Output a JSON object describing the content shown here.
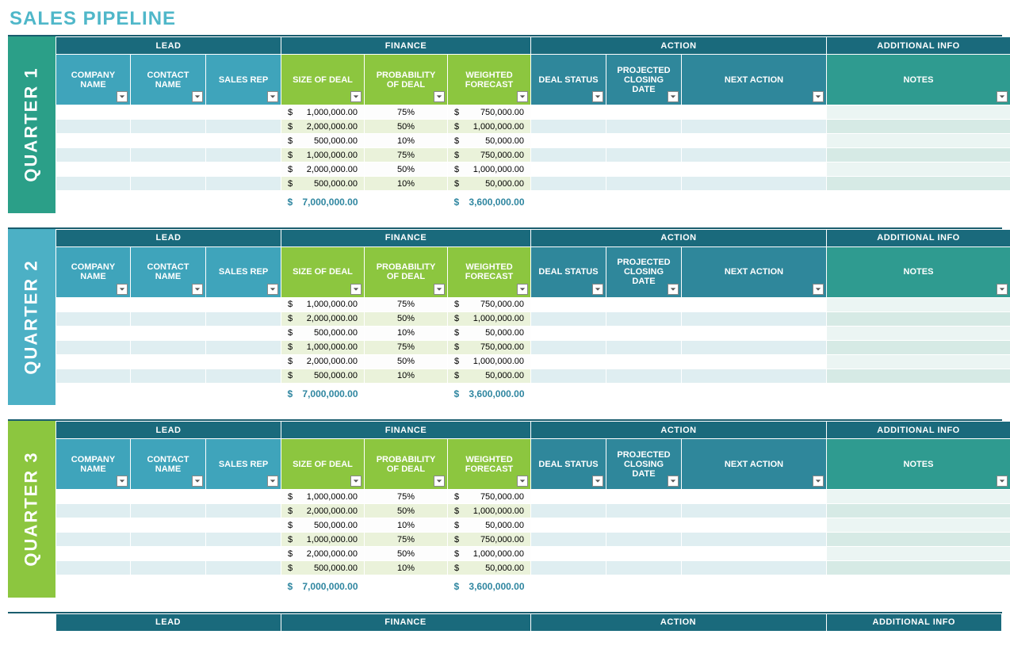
{
  "title": "SALES PIPELINE",
  "group_headers": {
    "lead": "LEAD",
    "finance": "FINANCE",
    "action": "ACTION",
    "info": "ADDITIONAL INFO"
  },
  "col_headers": {
    "company": "COMPANY NAME",
    "contact": "CONTACT NAME",
    "rep": "SALES REP",
    "size": "SIZE OF DEAL",
    "prob": "PROBABILITY OF DEAL",
    "forecast": "WEIGHTED FORECAST",
    "status": "DEAL STATUS",
    "closing": "PROJECTED CLOSING DATE",
    "next": "NEXT ACTION",
    "notes": "NOTES"
  },
  "currency": "$",
  "quarters": [
    {
      "id": "q1",
      "label": "QUARTER 1",
      "side_class": "q1",
      "rows": [
        {
          "size": "1,000,000.00",
          "prob": "75%",
          "forecast": "750,000.00"
        },
        {
          "size": "2,000,000.00",
          "prob": "50%",
          "forecast": "1,000,000.00"
        },
        {
          "size": "500,000.00",
          "prob": "10%",
          "forecast": "50,000.00"
        },
        {
          "size": "1,000,000.00",
          "prob": "75%",
          "forecast": "750,000.00"
        },
        {
          "size": "2,000,000.00",
          "prob": "50%",
          "forecast": "1,000,000.00"
        },
        {
          "size": "500,000.00",
          "prob": "10%",
          "forecast": "50,000.00"
        }
      ],
      "total": {
        "size": "7,000,000.00",
        "forecast": "3,600,000.00"
      }
    },
    {
      "id": "q2",
      "label": "QUARTER 2",
      "side_class": "q2",
      "rows": [
        {
          "size": "1,000,000.00",
          "prob": "75%",
          "forecast": "750,000.00"
        },
        {
          "size": "2,000,000.00",
          "prob": "50%",
          "forecast": "1,000,000.00"
        },
        {
          "size": "500,000.00",
          "prob": "10%",
          "forecast": "50,000.00"
        },
        {
          "size": "1,000,000.00",
          "prob": "75%",
          "forecast": "750,000.00"
        },
        {
          "size": "2,000,000.00",
          "prob": "50%",
          "forecast": "1,000,000.00"
        },
        {
          "size": "500,000.00",
          "prob": "10%",
          "forecast": "50,000.00"
        }
      ],
      "total": {
        "size": "7,000,000.00",
        "forecast": "3,600,000.00"
      }
    },
    {
      "id": "q3",
      "label": "QUARTER 3",
      "side_class": "q3",
      "rows": [
        {
          "size": "1,000,000.00",
          "prob": "75%",
          "forecast": "750,000.00"
        },
        {
          "size": "2,000,000.00",
          "prob": "50%",
          "forecast": "1,000,000.00"
        },
        {
          "size": "500,000.00",
          "prob": "10%",
          "forecast": "50,000.00"
        },
        {
          "size": "1,000,000.00",
          "prob": "75%",
          "forecast": "750,000.00"
        },
        {
          "size": "2,000,000.00",
          "prob": "50%",
          "forecast": "1,000,000.00"
        },
        {
          "size": "500,000.00",
          "prob": "10%",
          "forecast": "50,000.00"
        }
      ],
      "total": {
        "size": "7,000,000.00",
        "forecast": "3,600,000.00"
      }
    }
  ]
}
